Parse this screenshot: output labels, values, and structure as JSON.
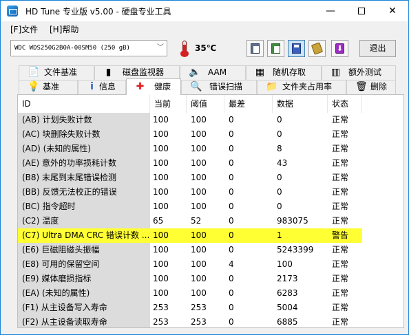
{
  "window": {
    "title": "HD Tune 专业版 v5.00 - 硬盘专业工具"
  },
  "menu": {
    "items": [
      "[F]文件",
      "[H]帮助"
    ]
  },
  "toolbar": {
    "drive": "WDC WDS250G2B0A-00SM50  (250 gB)",
    "temperature": "35℃",
    "exit_label": "退出"
  },
  "tabs_row1": [
    {
      "label": "文件基准",
      "icon": "file-benchmark-icon"
    },
    {
      "label": "磁盘监视器",
      "icon": "disk-monitor-icon"
    },
    {
      "label": "AAM",
      "icon": "speaker-icon"
    },
    {
      "label": "随机存取",
      "icon": "random-access-icon"
    },
    {
      "label": "额外测试",
      "icon": "extra-tests-icon"
    }
  ],
  "tabs_row2": [
    {
      "label": "基准",
      "icon": "benchmark-icon"
    },
    {
      "label": "信息",
      "icon": "info-icon"
    },
    {
      "label": "健康",
      "icon": "health-cross-icon"
    },
    {
      "label": "错误扫描",
      "icon": "error-scan-icon"
    },
    {
      "label": "文件夹占用率",
      "icon": "folder-usage-icon"
    },
    {
      "label": "删除",
      "icon": "trash-icon"
    }
  ],
  "active_tab": "健康",
  "health_table": {
    "headers": [
      "ID",
      "当前",
      "阈值",
      "最差",
      "数据",
      "状态"
    ],
    "rows": [
      [
        "(AB) 计划失败计数",
        "100",
        "100",
        "0",
        "0",
        "正常"
      ],
      [
        "(AC) 块删除失败计数",
        "100",
        "100",
        "0",
        "0",
        "正常"
      ],
      [
        "(AD) (未知的属性)",
        "100",
        "100",
        "0",
        "8",
        "正常"
      ],
      [
        "(AE) 意外的功率损耗计数",
        "100",
        "100",
        "0",
        "43",
        "正常"
      ],
      [
        "(B8) 末尾到末尾错误检测",
        "100",
        "100",
        "0",
        "0",
        "正常"
      ],
      [
        "(BB) 反馈无法校正的错误",
        "100",
        "100",
        "0",
        "0",
        "正常"
      ],
      [
        "(BC) 指令超时",
        "100",
        "100",
        "0",
        "0",
        "正常"
      ],
      [
        "(C2) 温度",
        "65",
        "52",
        "0",
        "983075",
        "正常"
      ],
      [
        "(C7) Ultra DMA CRC 错误计数 ...",
        "100",
        "100",
        "0",
        "1",
        "警告"
      ],
      [
        "(E6) 巨磁阻磁头振幅",
        "100",
        "100",
        "0",
        "5243399",
        "正常"
      ],
      [
        "(E8) 可用的保留空间",
        "100",
        "100",
        "4",
        "100",
        "正常"
      ],
      [
        "(E9) 媒体磨损指标",
        "100",
        "100",
        "0",
        "2173",
        "正常"
      ],
      [
        "(EA) (未知的属性)",
        "100",
        "100",
        "0",
        "6283",
        "正常"
      ],
      [
        "(F1) 从主设备写入寿命",
        "253",
        "253",
        "0",
        "5004",
        "正常"
      ],
      [
        "(F2) 从主设备读取寿命",
        "253",
        "253",
        "0",
        "6885",
        "正常"
      ]
    ],
    "warning_row_index": 8,
    "warning_color": "#ffff33"
  }
}
